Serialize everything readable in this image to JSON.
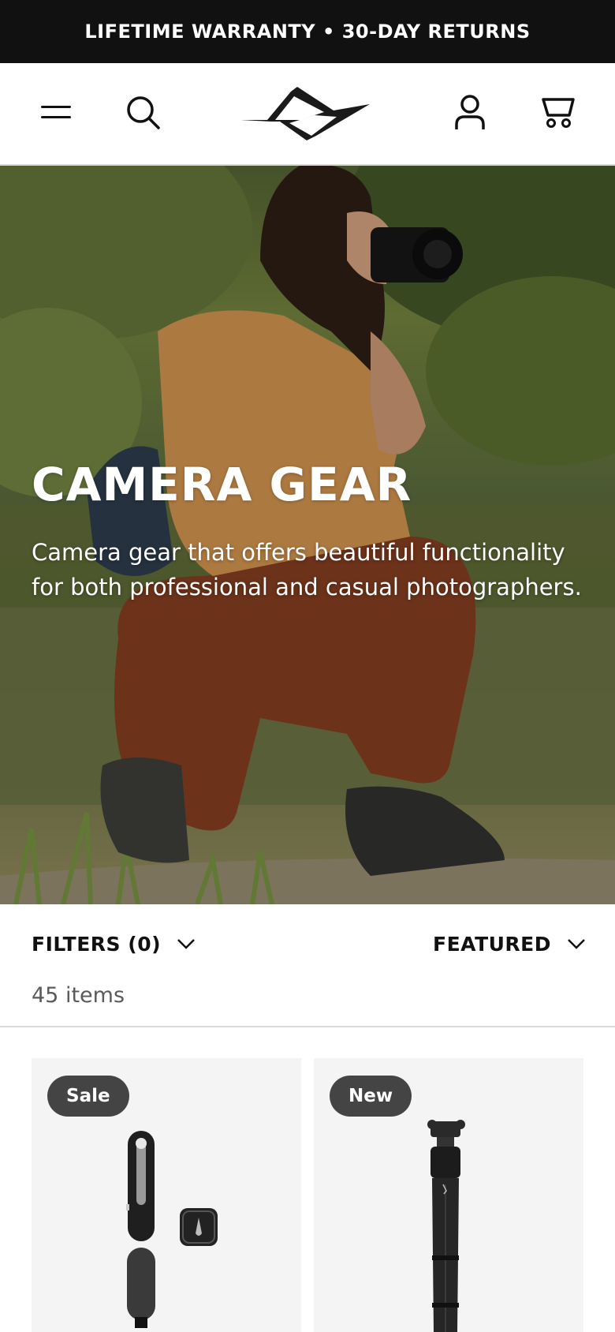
{
  "announcement": {
    "text": "LIFETIME WARRANTY • 30-DAY RETURNS"
  },
  "header": {
    "icons": [
      "menu-icon",
      "search-icon",
      "brand-logo",
      "account-icon",
      "cart-icon"
    ]
  },
  "hero": {
    "title": "CAMERA GEAR",
    "subtitle_line1": "Camera gear that offers beautiful functionality",
    "subtitle_line2": "for both professional and casual photographers."
  },
  "toolbar": {
    "filters_label": "FILTERS (0)",
    "sort_label": "FEATURED",
    "item_count": "45 items"
  },
  "products": [
    {
      "badge": "Sale"
    },
    {
      "badge": "New"
    }
  ],
  "colors": {
    "announcement_bg": "#111111",
    "badge_bg": "#444444",
    "card_bg": "#f4f4f4",
    "text_primary": "#111111",
    "text_muted": "#5a5a5a"
  }
}
